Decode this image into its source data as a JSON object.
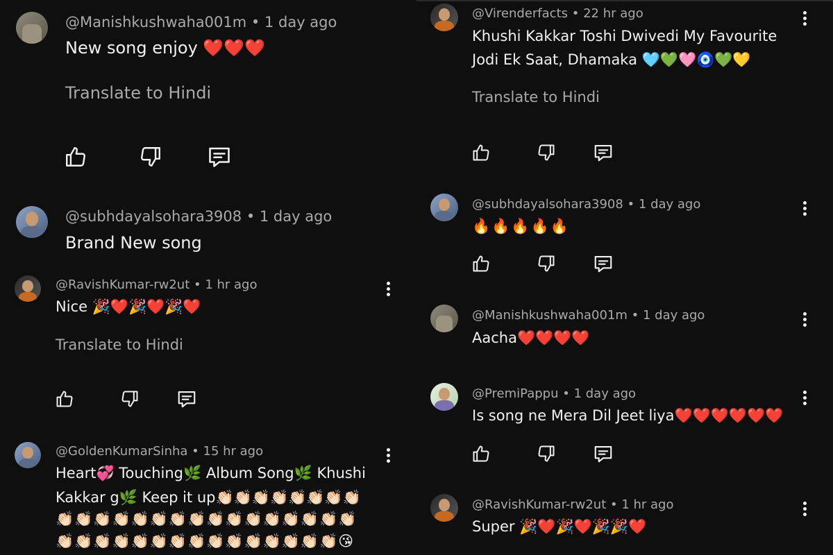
{
  "left": {
    "c1": {
      "handle": "@Manishkushwaha001m",
      "time": "1 day ago",
      "text": "New song enjoy ❤️❤️❤️",
      "translate": "Translate to Hindi"
    },
    "c2": {
      "handle": "@subhdayalsohara3908",
      "time": "1 day ago",
      "text": "Brand New song"
    },
    "c3": {
      "handle": "@RavishKumar-rw2ut",
      "time": "1 hr ago",
      "text": "Nice 🎉❤️🎉❤️🎉❤️",
      "translate": "Translate to Hindi"
    },
    "c4": {
      "handle": "@GoldenKumarSinha",
      "time": "15 hr ago",
      "line1": "Heart💞 Touching🌿 Album Song🌿 Khushi",
      "line2": "Kakkar g🌿 Keep it up👏🏻👏🏻👏🏻👏🏻👏🏻👏🏻👏🏻👏🏻",
      "line3": "👏🏻👏🏻👏🏻👏🏻👏🏻👏🏻👏🏻👏🏻👏🏻👏🏻👏🏻👏🏻👏🏻👏🏻👏🏻👏🏻",
      "line4": "👏🏻👏🏻👏🏻👏🏻👏🏻👏🏻👏🏻👏🏻👏🏻👏🏻👏🏻👏🏻👏🏻👏🏻👏🏻😘"
    }
  },
  "right": {
    "c1": {
      "handle": "@Virenderfacts",
      "time": "22 hr ago",
      "line1": "Khushi Kakkar Toshi Dwivedi My Favourite",
      "line2": "Jodi Ek Saat, Dhamaka 🩵💚🩷🧿💚💛",
      "translate": "Translate to Hindi"
    },
    "c2": {
      "handle": "@subhdayalsohara3908",
      "time": "1 day ago",
      "text": "🔥🔥🔥🔥🔥"
    },
    "c3": {
      "handle": "@Manishkushwaha001m",
      "time": "1 day ago",
      "text": "Aacha❤️❤️❤️❤️"
    },
    "c4": {
      "handle": "@PremiPappu",
      "time": "1 day ago",
      "text": "Is song ne Mera Dil Jeet liya❤️❤️❤️❤️❤️❤️"
    },
    "c5": {
      "handle": "@RavishKumar-rw2ut",
      "time": "1 hr ago",
      "text": "Super 🎉❤️🎉❤️🎉🎉❤️"
    }
  },
  "separator": " • ",
  "icons": {
    "like": "thumbs-up-icon",
    "dislike": "thumbs-down-icon",
    "reply": "reply-icon",
    "more": "more-vert-icon"
  },
  "colors": {
    "background": "#0f0f0f",
    "primary_text": "#f1f1f1",
    "secondary_text": "#aaaaaa"
  }
}
